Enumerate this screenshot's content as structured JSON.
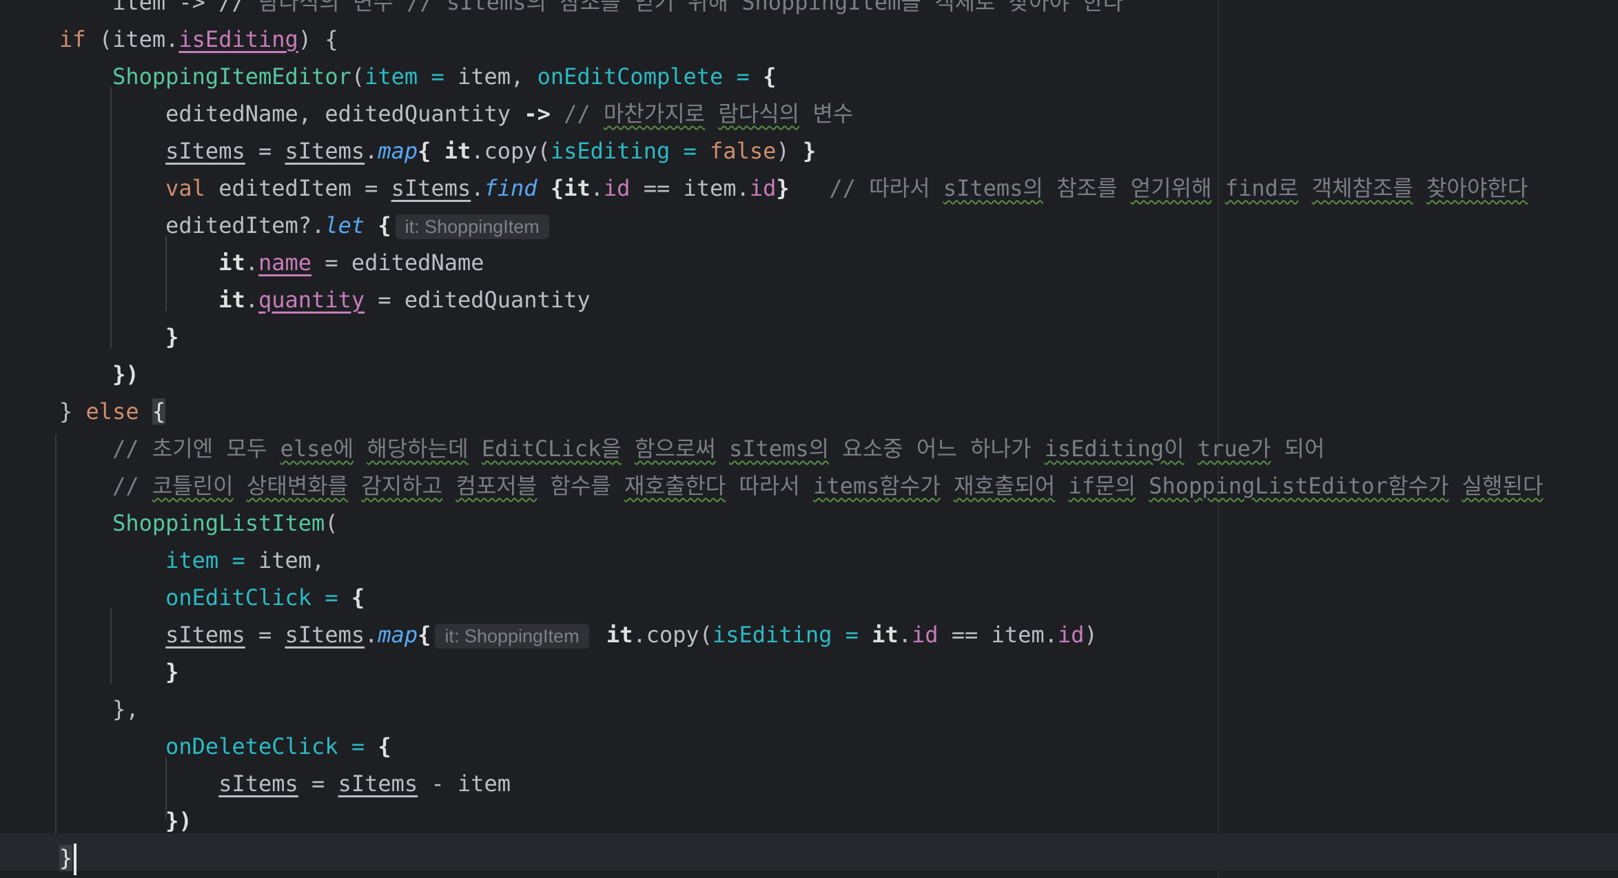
{
  "editor": {
    "lines": [
      [
        {
          "t": "    item -> // ",
          "c": "plain"
        },
        {
          "t": "람다식의 변수 // sItems의 참조를 얻기 위해 ShoppingItem을 객체로 찾아야 한다",
          "c": "cmt"
        }
      ],
      [
        {
          "t": "if ",
          "c": "kw"
        },
        {
          "t": "(item.",
          "c": "plain"
        },
        {
          "t": "isEditing",
          "c": "prop ul"
        },
        {
          "t": ") {",
          "c": "plain"
        }
      ],
      [
        {
          "t": "    ShoppingItemEditor",
          "c": "call"
        },
        {
          "t": "(",
          "c": "plain"
        },
        {
          "t": "item = ",
          "c": "param"
        },
        {
          "t": "item, ",
          "c": "plain"
        },
        {
          "t": "onEditComplete = ",
          "c": "param"
        },
        {
          "t": "{",
          "c": "bold"
        }
      ],
      [
        {
          "t": "        editedName, editedQuantity ",
          "c": "plain"
        },
        {
          "t": "->",
          "c": "bold"
        },
        {
          "t": " // ",
          "c": "cmt"
        },
        {
          "t": "마찬가지로",
          "c": "cmt squig"
        },
        {
          "t": " ",
          "c": "cmt"
        },
        {
          "t": "람다식의",
          "c": "cmt squig"
        },
        {
          "t": " 변수",
          "c": "cmt"
        }
      ],
      [
        {
          "t": "        ",
          "c": "plain"
        },
        {
          "t": "sItems",
          "c": "plain ul"
        },
        {
          "t": " = ",
          "c": "plain"
        },
        {
          "t": "sItems",
          "c": "plain ul"
        },
        {
          "t": ".",
          "c": "plain"
        },
        {
          "t": "map",
          "c": "ital"
        },
        {
          "t": "{ ",
          "c": "bold"
        },
        {
          "t": "it",
          "c": "bold"
        },
        {
          "t": ".copy(",
          "c": "plain"
        },
        {
          "t": "isEditing = ",
          "c": "param"
        },
        {
          "t": "false",
          "c": "kw"
        },
        {
          "t": ") ",
          "c": "plain"
        },
        {
          "t": "}",
          "c": "bold"
        }
      ],
      [
        {
          "t": "        ",
          "c": "plain"
        },
        {
          "t": "val ",
          "c": "kw"
        },
        {
          "t": "editedItem = ",
          "c": "plain"
        },
        {
          "t": "sItems",
          "c": "plain ul"
        },
        {
          "t": ".",
          "c": "plain"
        },
        {
          "t": "find",
          "c": "ital"
        },
        {
          "t": " {",
          "c": "bold"
        },
        {
          "t": "it",
          "c": "bold"
        },
        {
          "t": ".",
          "c": "plain"
        },
        {
          "t": "id",
          "c": "prop"
        },
        {
          "t": " == item.",
          "c": "plain"
        },
        {
          "t": "id",
          "c": "prop"
        },
        {
          "t": "}",
          "c": "bold"
        },
        {
          "t": "   // 따라서 ",
          "c": "cmt"
        },
        {
          "t": "sItems의",
          "c": "cmt squig"
        },
        {
          "t": " 참조를 ",
          "c": "cmt"
        },
        {
          "t": "얻기위해",
          "c": "cmt squig"
        },
        {
          "t": " ",
          "c": "cmt"
        },
        {
          "t": "find로",
          "c": "cmt squig"
        },
        {
          "t": " ",
          "c": "cmt"
        },
        {
          "t": "객체참조를",
          "c": "cmt squig"
        },
        {
          "t": " ",
          "c": "cmt"
        },
        {
          "t": "찾아야한다",
          "c": "cmt squig"
        }
      ],
      [
        {
          "t": "        editedItem?.",
          "c": "plain"
        },
        {
          "t": "let",
          "c": "ital"
        },
        {
          "t": " {",
          "c": "bold"
        },
        {
          "h": "it: ShoppingItem"
        }
      ],
      [
        {
          "t": "            ",
          "c": "plain"
        },
        {
          "t": "it",
          "c": "bold"
        },
        {
          "t": ".",
          "c": "plain"
        },
        {
          "t": "name",
          "c": "prop ul"
        },
        {
          "t": " = editedName",
          "c": "plain"
        }
      ],
      [
        {
          "t": "            ",
          "c": "plain"
        },
        {
          "t": "it",
          "c": "bold"
        },
        {
          "t": ".",
          "c": "plain"
        },
        {
          "t": "quantity",
          "c": "prop ul"
        },
        {
          "t": " = editedQuantity",
          "c": "plain"
        }
      ],
      [
        {
          "t": "        }",
          "c": "bold"
        }
      ],
      [
        {
          "t": "    ",
          "c": "plain"
        },
        {
          "t": "})",
          "c": "bold"
        }
      ],
      [
        {
          "t": "} ",
          "c": "plain"
        },
        {
          "t": "else ",
          "c": "kw"
        },
        {
          "t": "{",
          "c": "brace-hl"
        }
      ],
      [
        {
          "t": "    // 초기엔 모두 ",
          "c": "cmt"
        },
        {
          "t": "else에",
          "c": "cmt squig"
        },
        {
          "t": " ",
          "c": "cmt"
        },
        {
          "t": "해당하는데",
          "c": "cmt squig"
        },
        {
          "t": " ",
          "c": "cmt"
        },
        {
          "t": "EditCLick을",
          "c": "cmt squig"
        },
        {
          "t": " ",
          "c": "cmt"
        },
        {
          "t": "함으로써",
          "c": "cmt squig"
        },
        {
          "t": " ",
          "c": "cmt"
        },
        {
          "t": "sItems의",
          "c": "cmt squig"
        },
        {
          "t": " 요소중 어느 하나가 ",
          "c": "cmt"
        },
        {
          "t": "isEditing이",
          "c": "cmt squig"
        },
        {
          "t": " ",
          "c": "cmt"
        },
        {
          "t": "true가",
          "c": "cmt squig"
        },
        {
          "t": " 되어",
          "c": "cmt"
        }
      ],
      [
        {
          "t": "    // ",
          "c": "cmt"
        },
        {
          "t": "코틀린이",
          "c": "cmt squig"
        },
        {
          "t": " ",
          "c": "cmt"
        },
        {
          "t": "상태변화를",
          "c": "cmt squig"
        },
        {
          "t": " ",
          "c": "cmt"
        },
        {
          "t": "감지하고",
          "c": "cmt squig"
        },
        {
          "t": " ",
          "c": "cmt"
        },
        {
          "t": "컴포저블",
          "c": "cmt squig"
        },
        {
          "t": " 함수를 ",
          "c": "cmt"
        },
        {
          "t": "재호출한다",
          "c": "cmt squig"
        },
        {
          "t": " 따라서 ",
          "c": "cmt"
        },
        {
          "t": "items함수가",
          "c": "cmt squig"
        },
        {
          "t": " ",
          "c": "cmt"
        },
        {
          "t": "재호출되어",
          "c": "cmt squig"
        },
        {
          "t": " ",
          "c": "cmt"
        },
        {
          "t": "if문의",
          "c": "cmt squig"
        },
        {
          "t": " ",
          "c": "cmt"
        },
        {
          "t": "ShoppingListEditor함수가",
          "c": "cmt squig"
        },
        {
          "t": " ",
          "c": "cmt"
        },
        {
          "t": "실행된다",
          "c": "cmt squig"
        }
      ],
      [
        {
          "t": "    ShoppingListItem",
          "c": "call"
        },
        {
          "t": "(",
          "c": "plain"
        }
      ],
      [
        {
          "t": "        ",
          "c": "plain"
        },
        {
          "t": "item = ",
          "c": "param"
        },
        {
          "t": "item,",
          "c": "plain"
        }
      ],
      [
        {
          "t": "        ",
          "c": "plain"
        },
        {
          "t": "onEditClick = ",
          "c": "param"
        },
        {
          "t": "{",
          "c": "bold"
        }
      ],
      [
        {
          "t": "        ",
          "c": "plain"
        },
        {
          "t": "sItems",
          "c": "plain ul"
        },
        {
          "t": " = ",
          "c": "plain"
        },
        {
          "t": "sItems",
          "c": "plain ul"
        },
        {
          "t": ".",
          "c": "plain"
        },
        {
          "t": "map",
          "c": "ital"
        },
        {
          "t": "{",
          "c": "bold"
        },
        {
          "h": "it: ShoppingItem"
        },
        {
          "t": " ",
          "c": "plain"
        },
        {
          "t": "it",
          "c": "bold"
        },
        {
          "t": ".copy(",
          "c": "plain"
        },
        {
          "t": "isEditing = ",
          "c": "param"
        },
        {
          "t": "it",
          "c": "bold"
        },
        {
          "t": ".",
          "c": "plain"
        },
        {
          "t": "id",
          "c": "prop"
        },
        {
          "t": " == item.",
          "c": "plain"
        },
        {
          "t": "id",
          "c": "prop"
        },
        {
          "t": ")",
          "c": "plain"
        }
      ],
      [
        {
          "t": "        }",
          "c": "bold"
        }
      ],
      [
        {
          "t": "    },",
          "c": "plain"
        }
      ],
      [
        {
          "t": "        ",
          "c": "plain"
        },
        {
          "t": "onDeleteClick = ",
          "c": "param"
        },
        {
          "t": "{",
          "c": "bold"
        }
      ],
      [
        {
          "t": "            ",
          "c": "plain"
        },
        {
          "t": "sItems",
          "c": "plain ul"
        },
        {
          "t": " = ",
          "c": "plain"
        },
        {
          "t": "sItems",
          "c": "plain ul"
        },
        {
          "t": " - item",
          "c": "plain"
        }
      ],
      [
        {
          "t": "        })",
          "c": "bold"
        }
      ],
      [
        {
          "t": "}",
          "c": "brace-hl"
        },
        {
          "caret": true
        }
      ]
    ]
  }
}
